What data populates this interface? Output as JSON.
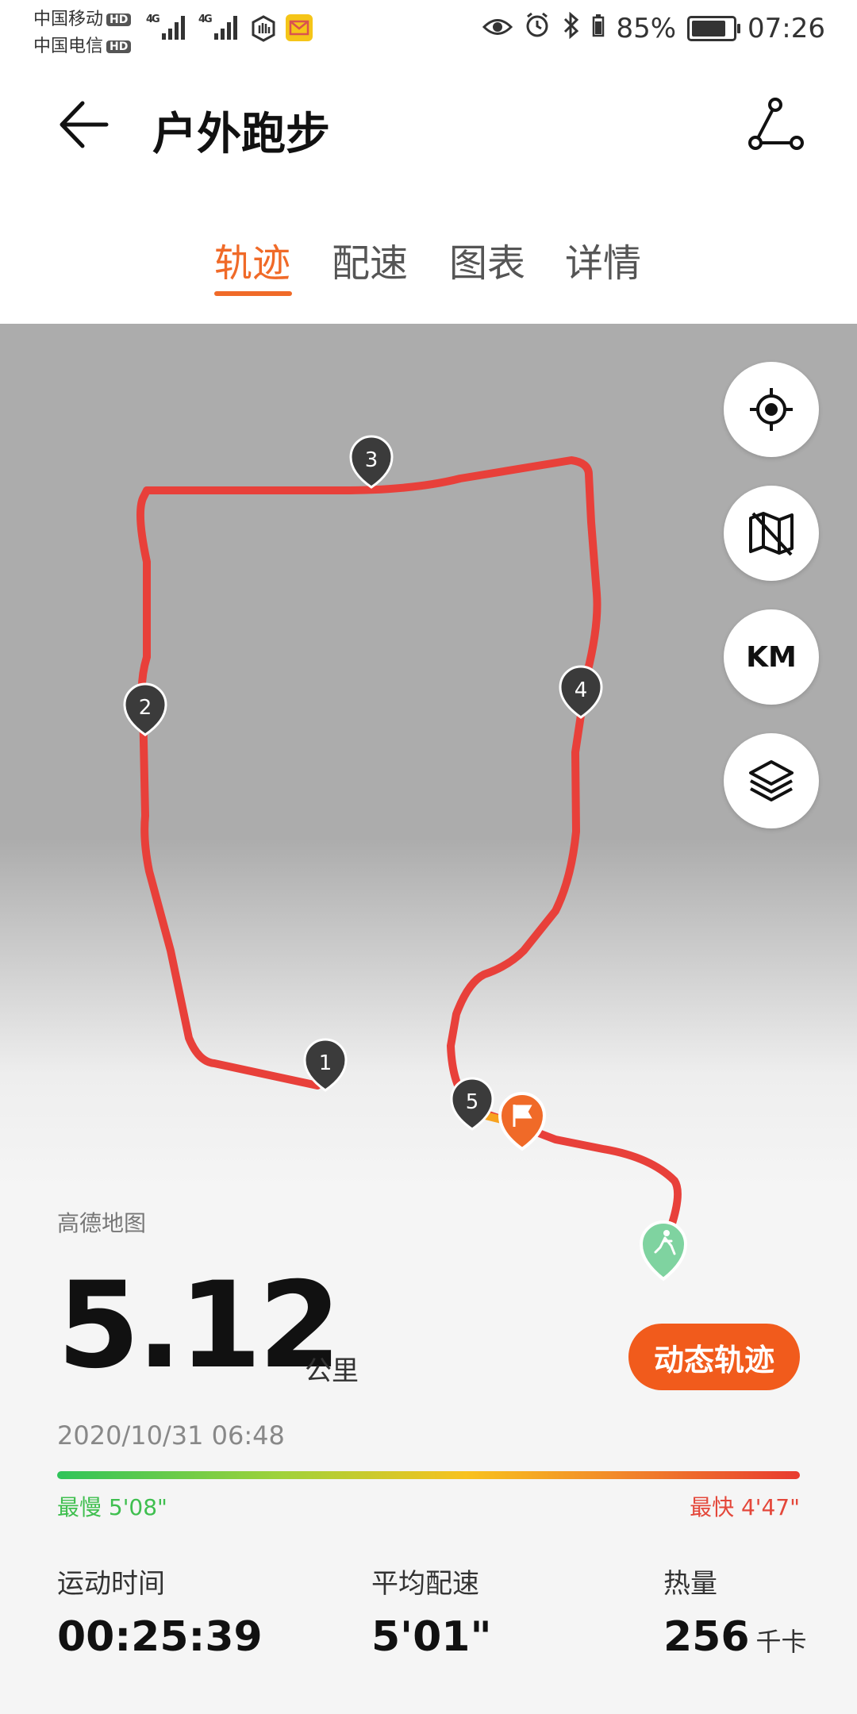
{
  "status_bar": {
    "carrier_1": "中国移动",
    "carrier_2": "中国电信",
    "hd": "HD",
    "network": "4G",
    "battery_percent": "85%",
    "battery_level": 0.85,
    "time": "07:26"
  },
  "header": {
    "title": "户外跑步"
  },
  "tabs": [
    {
      "label": "轨迹",
      "active": true
    },
    {
      "label": "配速",
      "active": false
    },
    {
      "label": "图表",
      "active": false
    },
    {
      "label": "详情",
      "active": false
    }
  ],
  "map": {
    "source": "高德地图",
    "km_button": "KM",
    "markers": [
      "1",
      "2",
      "3",
      "4",
      "5"
    ],
    "route_color": "#e8403a",
    "finish_flag_color": "#f06a28",
    "start_pin_color": "#7fd3a0"
  },
  "summary": {
    "distance": "5.12",
    "distance_unit": "公里",
    "dynamic_button": "动态轨迹",
    "datetime": "2020/10/31 06:48",
    "slowest": "最慢 5'08\"",
    "fastest": "最快 4'47\""
  },
  "stats": [
    {
      "label": "运动时间",
      "value": "00:25:39",
      "unit": ""
    },
    {
      "label": "平均配速",
      "value": "5'01\"",
      "unit": ""
    },
    {
      "label": "热量",
      "value": "256",
      "unit": "千卡"
    }
  ],
  "colors": {
    "accent": "#f06a28",
    "button": "#f15b1c"
  }
}
